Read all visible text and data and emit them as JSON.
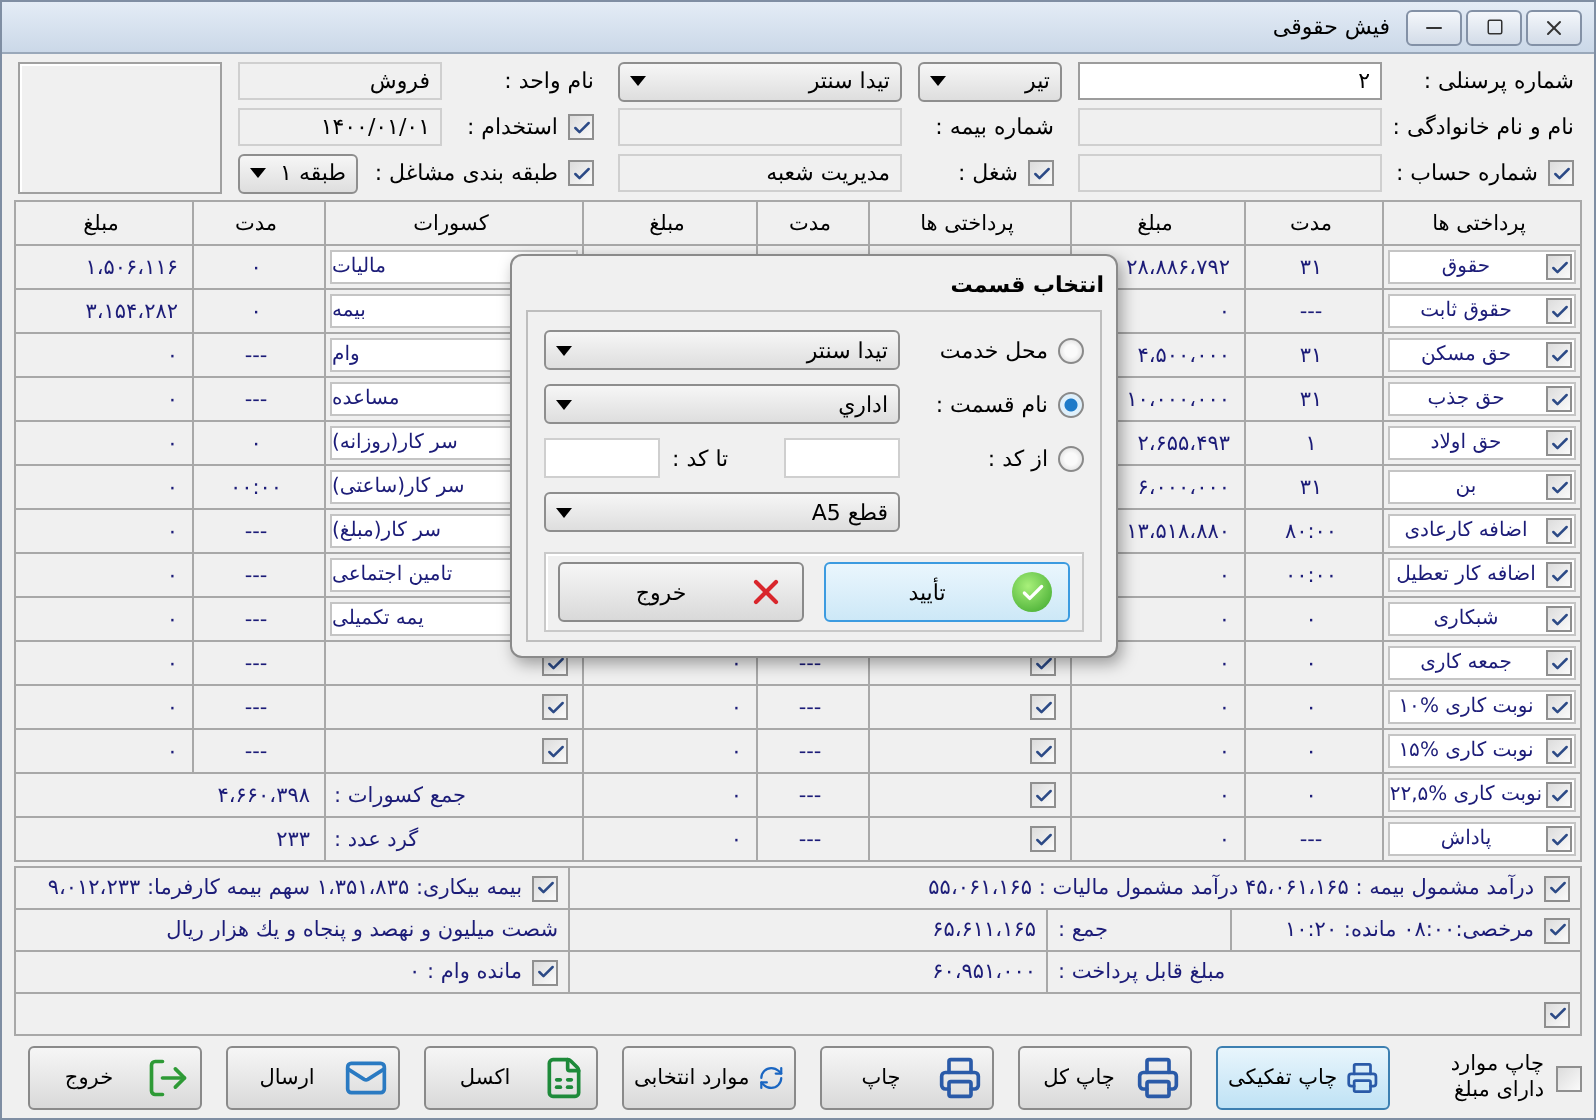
{
  "window": {
    "title": "فیش حقوقی"
  },
  "header": {
    "personnel_no": {
      "label": "شماره پرسنلی :",
      "value": "۲"
    },
    "month": {
      "value": "تیر"
    },
    "location": {
      "value": "تیدا سنتر"
    },
    "unit": {
      "label": "نام واحد :",
      "value": "فروش"
    },
    "full_name": {
      "label": "نام و نام خانوادگی :"
    },
    "insurance_no": {
      "label": "شماره بیمه :"
    },
    "employment": {
      "label": "استخدام :",
      "checked": true,
      "value": "۱۴۰۰/۰۱/۰۱"
    },
    "account_no": {
      "label": "شماره حساب :",
      "checked": true
    },
    "job": {
      "label": "شغل :",
      "checked": true,
      "value": "مدیریت شعبه"
    },
    "job_class": {
      "label": "طبقه بندی مشاغل :",
      "checked": true,
      "value": "طبقه ۱"
    }
  },
  "table": {
    "columns": [
      "پرداختی ها",
      "مدت",
      "مبلغ",
      "پرداختی ها",
      "مدت",
      "مبلغ",
      "کسورات",
      "مدت",
      "مبلغ"
    ]
  },
  "payments": [
    {
      "name": "حقوق",
      "checked": true,
      "duration": "۳۱",
      "amount": "۲۸،۸۸۶،۷۹۲"
    },
    {
      "name": "حقوق ثابت",
      "checked": true,
      "duration": "---",
      "amount": "۰"
    },
    {
      "name": "حق مسکن",
      "checked": true,
      "duration": "۳۱",
      "amount": "۴،۵۰۰،۰۰۰"
    },
    {
      "name": "حق جذب",
      "checked": true,
      "duration": "۳۱",
      "amount": "۱۰،۰۰۰،۰۰۰"
    },
    {
      "name": "حق اولاد",
      "checked": true,
      "duration": "۱",
      "amount": "۲،۶۵۵،۴۹۳"
    },
    {
      "name": "بن",
      "checked": true,
      "duration": "۳۱",
      "amount": "۶،۰۰۰،۰۰۰"
    },
    {
      "name": "اضافه کارعادی",
      "checked": true,
      "duration": "۸۰:۰۰",
      "amount": "۱۳،۵۱۸،۸۸۰"
    },
    {
      "name": "اضافه کار تعطیل",
      "checked": true,
      "duration": "۰۰:۰۰",
      "amount": "۰"
    },
    {
      "name": "شبکاری",
      "checked": true,
      "duration": "۰",
      "amount": "۰"
    },
    {
      "name": "جمعه کاری",
      "checked": true,
      "duration": "۰",
      "amount": "۰"
    },
    {
      "name": "نوبت کاری %۱۰",
      "checked": true,
      "duration": "۰",
      "amount": "۰"
    },
    {
      "name": "نوبت کاری %۱۵",
      "checked": true,
      "duration": "۰",
      "amount": "۰"
    },
    {
      "name": "نوبت کاری %۲۲,۵",
      "checked": true,
      "duration": "۰",
      "amount": "۰"
    },
    {
      "name": "پاداش",
      "checked": true,
      "duration": "---",
      "amount": "۰"
    }
  ],
  "payments_2": [
    {
      "checked": true,
      "duration": "---",
      "amount": "۰"
    },
    {
      "checked": true,
      "duration": "---",
      "amount": "۰"
    },
    {
      "checked": true,
      "duration": "---",
      "amount": "۰"
    },
    {
      "checked": true,
      "duration": "---",
      "amount": "۰"
    },
    {
      "checked": true,
      "duration": "---",
      "amount": "۰"
    }
  ],
  "deductions": [
    {
      "name": "مالیات",
      "duration": "۰",
      "amount": "۱،۵۰۶،۱۱۶"
    },
    {
      "name": "بیمه",
      "duration": "۰",
      "amount": "۳،۱۵۴،۲۸۲"
    },
    {
      "name": "وام",
      "duration": "---",
      "amount": "۰"
    },
    {
      "name": "مساعده",
      "duration": "---",
      "amount": "۰"
    },
    {
      "name": "سر کار(روزانه)",
      "duration": "۰",
      "amount": "۰"
    },
    {
      "name": "سر کار(ساعتی)",
      "duration": "۰۰:۰۰",
      "amount": "۰"
    },
    {
      "name": "سر کار(مبلغ)",
      "duration": "---",
      "amount": "۰"
    },
    {
      "name": "تامین اجتماعی",
      "duration": "---",
      "amount": "۰"
    },
    {
      "name": "یمه تکمیلی",
      "duration": "---",
      "amount": "۰"
    },
    {
      "checked": true,
      "duration": "---",
      "amount": "۰"
    },
    {
      "checked": true,
      "duration": "---",
      "amount": "۰"
    },
    {
      "checked": true,
      "duration": "---",
      "amount": "۰"
    }
  ],
  "deduction_totals": [
    {
      "label": "جمع کسورات :",
      "value": "۴،۶۶۰،۳۹۸"
    },
    {
      "label": "گرد عدد :",
      "value": "۲۳۳"
    }
  ],
  "summary": {
    "taxable": {
      "checked": true,
      "text": "درآمد مشمول بیمه : ۴۵،۰۶۱،۱۶۵ درآمد مشمول مالیات : ۵۵،۰۶۱،۱۶۵"
    },
    "unemployment": {
      "checked": true,
      "text": "بیمه بیکاری: ۱،۳۵۱،۸۳۵ سهم بیمه کارفرما: ۹،۰۱۲،۲۳۳"
    },
    "leave": {
      "checked": true,
      "text": "مرخصی:۰۸:۰۰ مانده: ۱۰:۲۰"
    },
    "sum": {
      "label": "جمع :",
      "value": "۶۵،۶۱۱،۱۶۵"
    },
    "sum_words": "شصت میلیون و نهصد و پنجاه و يك هزار ريال",
    "payable": {
      "label": "مبلغ قابل پرداخت :",
      "value": "۶۰،۹۵۱،۰۰۰"
    },
    "loan_balance": {
      "checked": true,
      "text": "مانده وام : ۰"
    },
    "extra": {
      "checked": true
    }
  },
  "print_option": {
    "label": "چاپ موارد دارای مبلغ",
    "checked": false
  },
  "buttons": [
    {
      "label": "چاپ تفکیکی",
      "kind": "print-split",
      "selected": true
    },
    {
      "label": "چاپ کل",
      "kind": "print-all",
      "selected": false
    },
    {
      "label": "چاپ",
      "kind": "print",
      "selected": false
    },
    {
      "label": "موارد انتخابی",
      "kind": "selection",
      "selected": false
    },
    {
      "label": "اکسل",
      "kind": "excel",
      "selected": false
    },
    {
      "label": "ارسال",
      "kind": "send",
      "selected": false
    },
    {
      "label": "خروج",
      "kind": "exit",
      "selected": false
    }
  ],
  "dialog": {
    "title": "انتخاب قسمت",
    "options": [
      {
        "kind": "select",
        "label": "محل خدمت",
        "selected": false,
        "value": "تیدا سنتر"
      },
      {
        "kind": "select",
        "label": "نام قسمت :",
        "selected": true,
        "value": "اداري"
      },
      {
        "kind": "range",
        "label": "از کد :",
        "selected": false,
        "to_label": "تا کد :"
      }
    ],
    "paper": {
      "value": "قطع A5"
    },
    "buttons": [
      {
        "kind": "confirm",
        "label": "تأیید"
      },
      {
        "kind": "exit",
        "label": "خروج"
      }
    ]
  }
}
